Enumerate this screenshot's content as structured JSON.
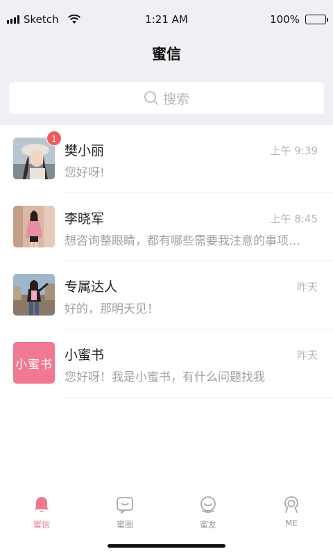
{
  "status_bar": {
    "carrier": "Sketch",
    "time": "1:21 AM",
    "battery": "100%"
  },
  "nav": {
    "title": "蜜信"
  },
  "search": {
    "placeholder": "搜索",
    "icon": "search-icon"
  },
  "chats": [
    {
      "name": "樊小丽",
      "time": "上午 9:39",
      "preview": "您好呀!",
      "badge": "1",
      "avatar": "photo-avatar"
    },
    {
      "name": "李晓军",
      "time": "上午 8:45",
      "preview": "想咨询整眼睛，都有哪些需要我注意的事项…",
      "avatar": "photo-avatar"
    },
    {
      "name": "专属达人",
      "time": "昨天",
      "preview": "好的，那明天见！",
      "avatar": "photo-avatar"
    },
    {
      "name": "小蜜书",
      "time": "昨天",
      "preview": "您好呀！我是小蜜书，有什么问题找我",
      "avatar_text": "小蜜书"
    }
  ],
  "tabs": [
    {
      "label": "蜜信",
      "icon": "bell-icon",
      "active": true
    },
    {
      "label": "蜜圈",
      "icon": "chat-bubble-icon",
      "active": false
    },
    {
      "label": "蜜友",
      "icon": "smiley-face-icon",
      "active": false
    },
    {
      "label": "ME",
      "icon": "profile-icon",
      "active": false
    }
  ],
  "colors": {
    "accent": "#f07891",
    "badge": "#f05a5a",
    "background_top": "#efeff4"
  }
}
